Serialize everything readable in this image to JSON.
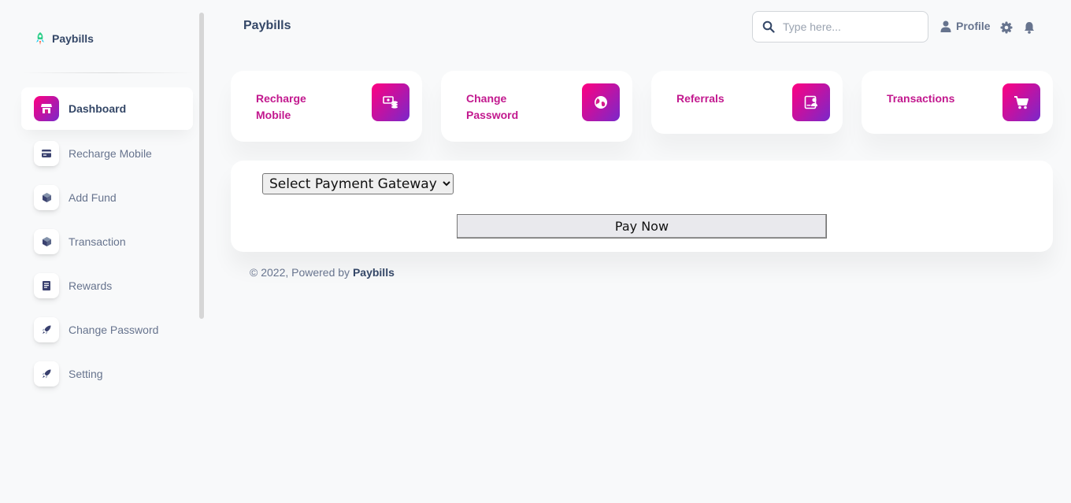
{
  "brand": {
    "name": "Paybills"
  },
  "sidebar": {
    "items": [
      {
        "label": "Dashboard",
        "icon": "shop-icon",
        "active": true
      },
      {
        "label": "Recharge Mobile",
        "icon": "card-icon"
      },
      {
        "label": "Add Fund",
        "icon": "box-icon"
      },
      {
        "label": "Transaction",
        "icon": "box-icon"
      },
      {
        "label": "Rewards",
        "icon": "document-icon"
      },
      {
        "label": "Change Password",
        "icon": "rocket-icon"
      },
      {
        "label": "Setting",
        "icon": "rocket-icon"
      }
    ]
  },
  "header": {
    "title": "Paybills",
    "search_placeholder": "Type here...",
    "profile_label": "Profile"
  },
  "cards": [
    {
      "label": "Recharge Mobile",
      "icon": "money-coins-icon"
    },
    {
      "label": "Change Password",
      "icon": "globe-icon"
    },
    {
      "label": "Referrals",
      "icon": "user-badge-icon"
    },
    {
      "label": "Transactions",
      "icon": "cart-icon"
    }
  ],
  "payment": {
    "gateway_selected": "Select Payment Gateway",
    "pay_label": "Pay Now"
  },
  "footer": {
    "text": "© 2022, Powered by ",
    "brand": "Paybills"
  },
  "colors": {
    "accent_gradient_start": "#7928ca",
    "accent_gradient_end": "#ff0080",
    "card_label": "#c2188e",
    "text_dark": "#344767",
    "text_muted": "#67748e"
  }
}
